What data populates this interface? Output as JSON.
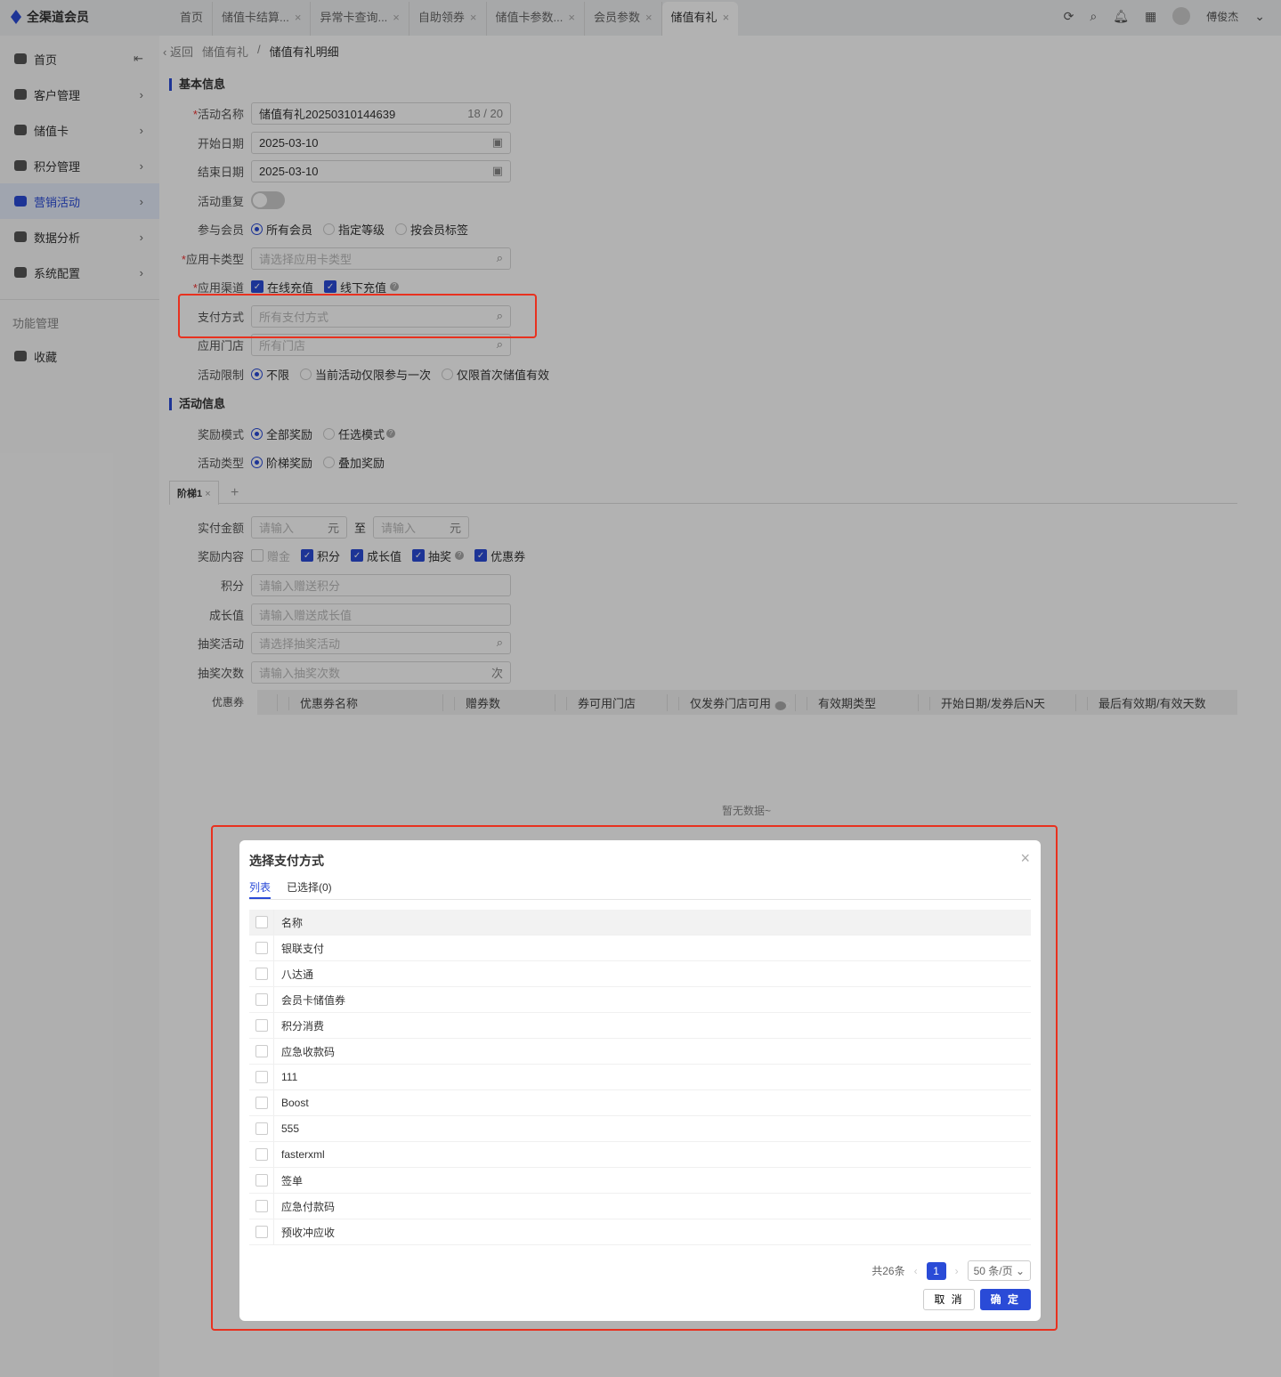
{
  "app": {
    "title": "全渠道会员",
    "user": "傅俊杰"
  },
  "tabs": [
    {
      "label": "首页",
      "closable": false
    },
    {
      "label": "储值卡结算...",
      "closable": true
    },
    {
      "label": "异常卡查询...",
      "closable": true
    },
    {
      "label": "自助领券",
      "closable": true
    },
    {
      "label": "储值卡参数...",
      "closable": true
    },
    {
      "label": "会员参数",
      "closable": true
    },
    {
      "label": "储值有礼",
      "closable": true,
      "active": true
    }
  ],
  "sidebar": {
    "items": [
      {
        "label": "首页"
      },
      {
        "label": "客户管理"
      },
      {
        "label": "储值卡"
      },
      {
        "label": "积分管理"
      },
      {
        "label": "营销活动",
        "active": true
      },
      {
        "label": "数据分析"
      },
      {
        "label": "系统配置"
      }
    ],
    "section": "功能管理",
    "fav": "收藏"
  },
  "breadcrumb": {
    "back": "返回",
    "parent": "储值有礼",
    "current": "储值有礼明细"
  },
  "basic": {
    "title": "基本信息",
    "name_label": "活动名称",
    "name_value": "储值有礼20250310144639",
    "name_count": "18 / 20",
    "start_label": "开始日期",
    "start_value": "2025-03-10",
    "end_label": "结束日期",
    "end_value": "2025-03-10",
    "repeat_label": "活动重复",
    "member_label": "参与会员",
    "member_opts": [
      "所有会员",
      "指定等级",
      "按会员标签"
    ],
    "cardtype_label": "应用卡类型",
    "cardtype_ph": "请选择应用卡类型",
    "channel_label": "应用渠道",
    "channel_opts": [
      "在线充值",
      "线下充值"
    ],
    "pay_label": "支付方式",
    "pay_ph": "所有支付方式",
    "store_label": "应用门店",
    "store_ph": "所有门店",
    "limit_label": "活动限制",
    "limit_opts": [
      "不限",
      "当前活动仅限参与一次",
      "仅限首次储值有效"
    ]
  },
  "activity": {
    "title": "活动信息",
    "mode_label": "奖励模式",
    "mode_opts": [
      "全部奖励",
      "任选模式"
    ],
    "type_label": "活动类型",
    "type_opts": [
      "阶梯奖励",
      "叠加奖励"
    ],
    "tier_tab": "阶梯1",
    "amount_label": "实付金额",
    "amount_ph": "请输入",
    "unit": "元",
    "to": "至",
    "reward_label": "奖励内容",
    "reward_opts": [
      "赠金",
      "积分",
      "成长值",
      "抽奖",
      "优惠券"
    ],
    "points_label": "积分",
    "points_ph": "请输入赠送积分",
    "growth_label": "成长值",
    "growth_ph": "请输入赠送成长值",
    "lottery_label": "抽奖活动",
    "lottery_ph": "请选择抽奖活动",
    "lottery_times_label": "抽奖次数",
    "lottery_times_ph": "请输入抽奖次数",
    "times_unit": "次",
    "coupon_label": "优惠券",
    "coupon_cols": [
      "优惠券名称",
      "赠券数",
      "券可用门店",
      "仅发券门店可用",
      "有效期类型",
      "开始日期/发券后N天",
      "最后有效期/有效天数"
    ],
    "empty": "暂无数据~"
  },
  "modal": {
    "title": "选择支付方式",
    "tabs": [
      "列表",
      "已选择(0)"
    ],
    "header": "名称",
    "rows": [
      "银联支付",
      "八达通",
      "会员卡储值券",
      "积分消费",
      "应急收款码",
      "111",
      "Boost",
      "555",
      "fasterxml",
      "签单",
      "应急付款码",
      "预收冲应收"
    ],
    "total": "共26条",
    "page": "1",
    "page_size": "50 条/页",
    "cancel": "取 消",
    "ok": "确 定"
  },
  "colors": {
    "accent": "#2a4bd7",
    "highlight": "#e8311f"
  }
}
